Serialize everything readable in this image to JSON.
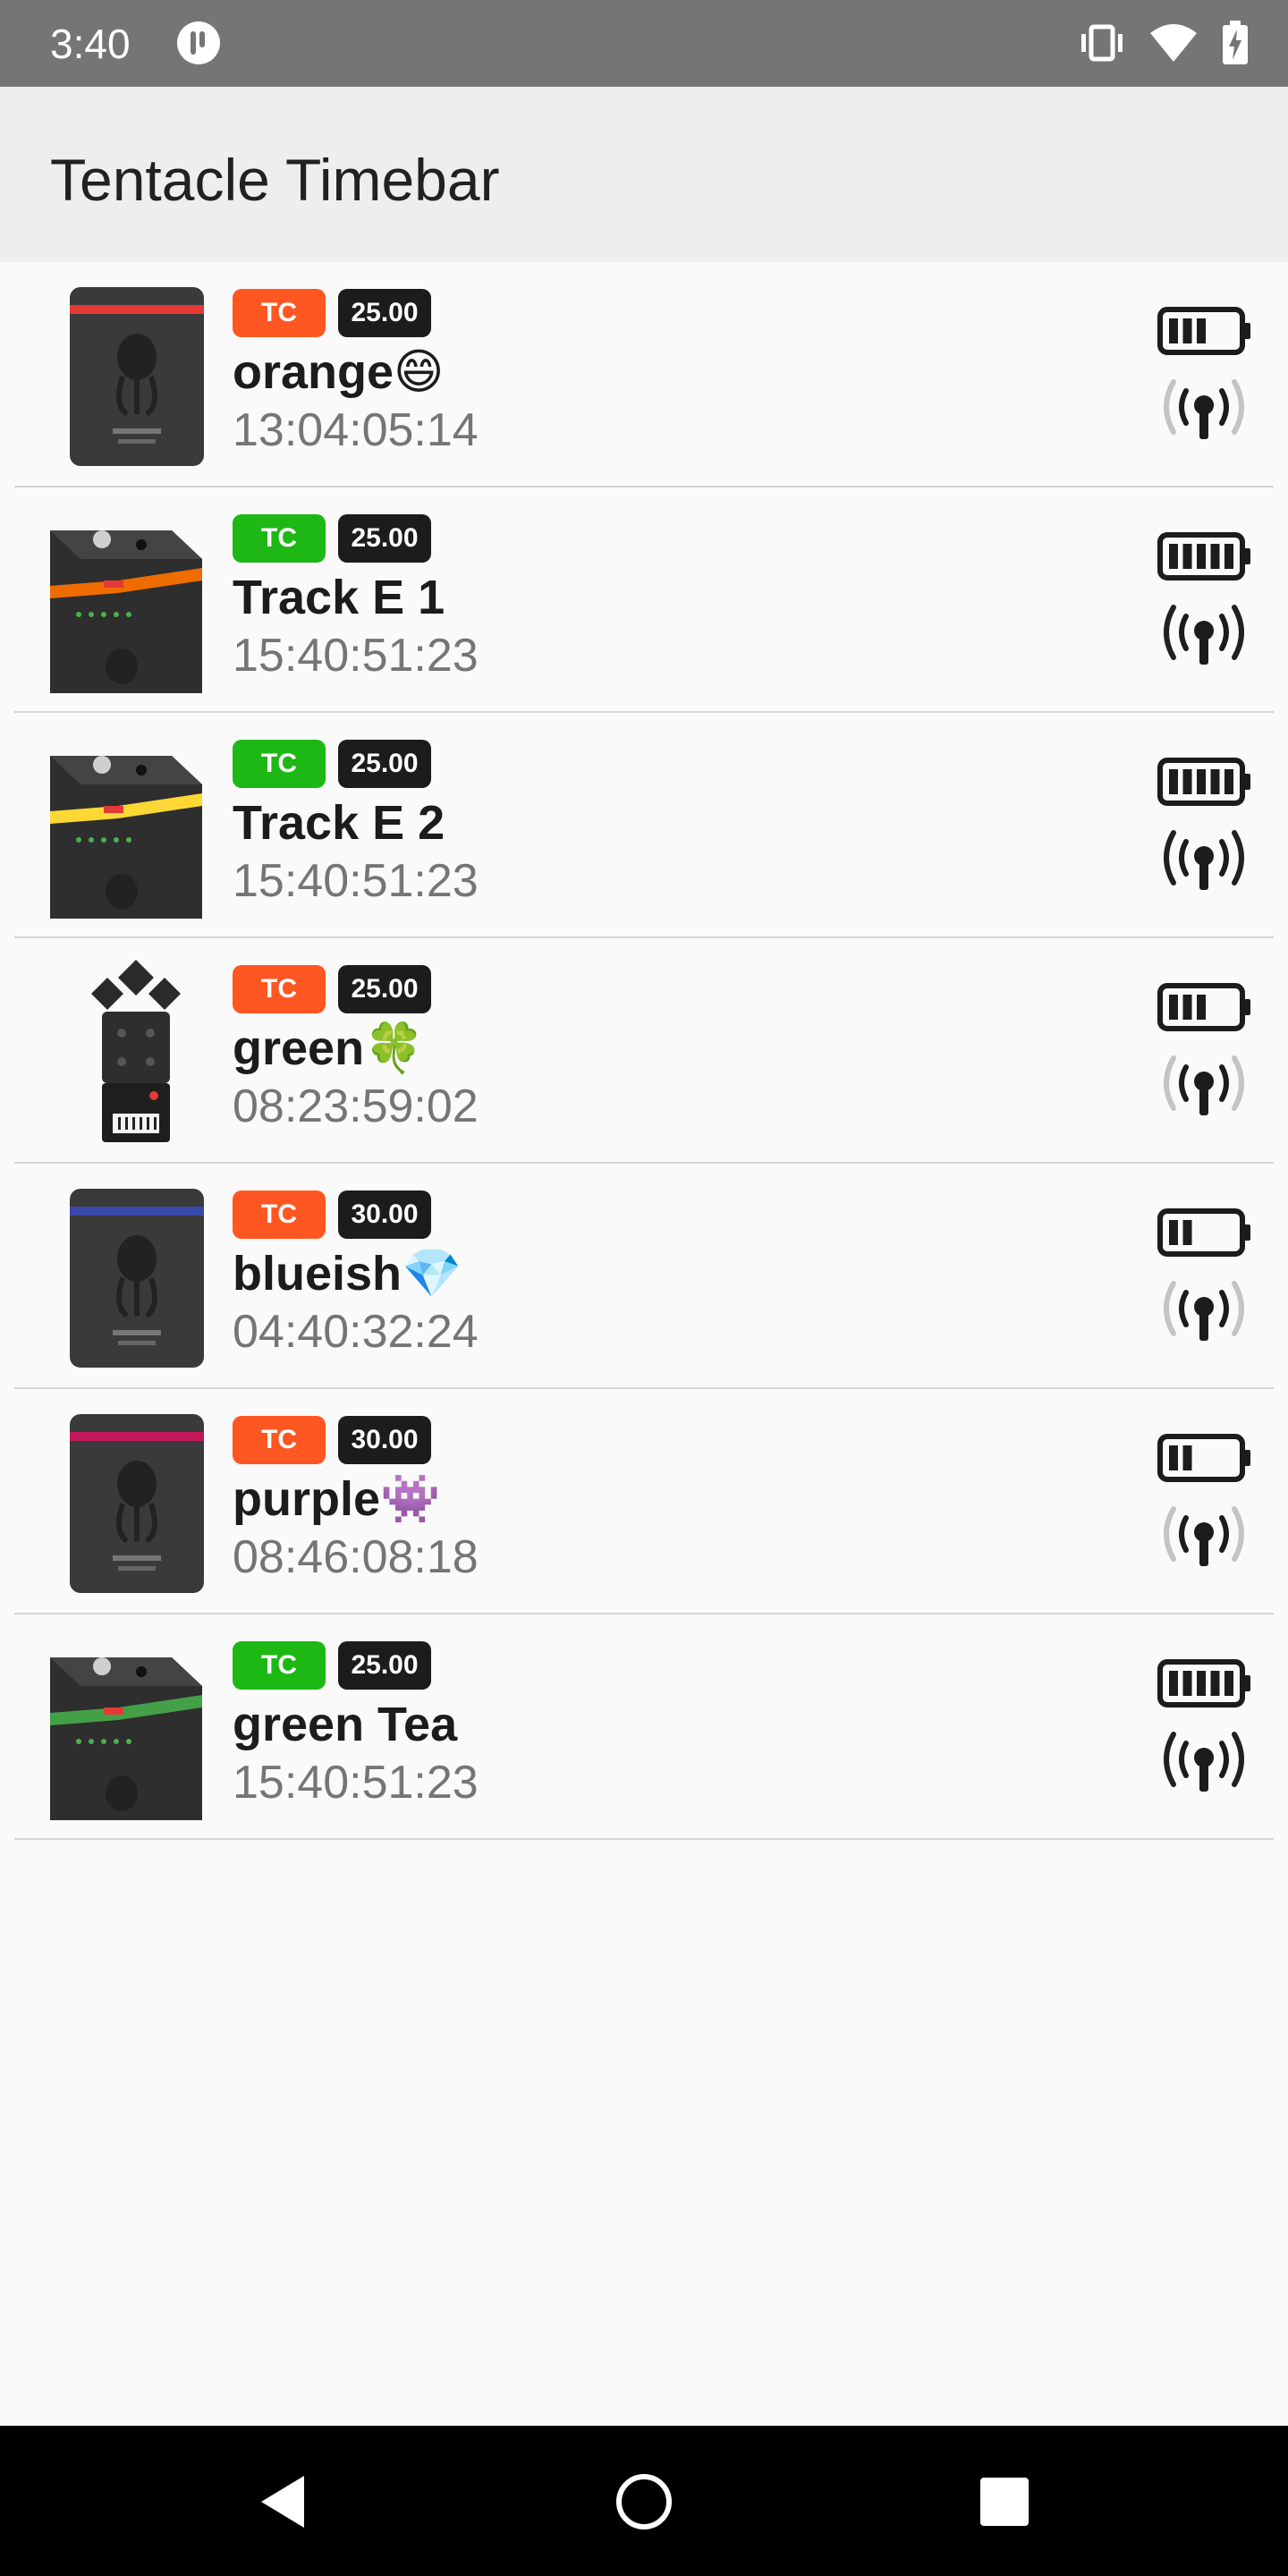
{
  "status_bar": {
    "time": "3:40"
  },
  "app_bar": {
    "title": "Tentacle Timebar",
    "accent": "#f4511e"
  },
  "colors": {
    "tc_orange": "#ff5722",
    "tc_green": "#1db814",
    "signal_strong": "#212121",
    "signal_weak": "#c4c4c4"
  },
  "devices": [
    {
      "tag": "TC",
      "fps": "25.00",
      "name": "orange😄",
      "timecode": "13:04:05:14",
      "tag_color": "#ff5722",
      "device_icon": "tentacle-sync-e-front-icon",
      "stripe": "#e53935",
      "battery_level": 3,
      "signal": "weak"
    },
    {
      "tag": "TC",
      "fps": "25.00",
      "name": "Track E 1",
      "timecode": "15:40:51:23",
      "tag_color": "#1db814",
      "device_icon": "tentacle-track-e-icon",
      "stripe": "#ef6c00",
      "battery_level": 5,
      "signal": "strong"
    },
    {
      "tag": "TC",
      "fps": "25.00",
      "name": "Track E 2",
      "timecode": "15:40:51:23",
      "tag_color": "#1db814",
      "device_icon": "tentacle-track-e-icon",
      "stripe": "#fdd835",
      "battery_level": 5,
      "signal": "strong"
    },
    {
      "tag": "TC",
      "fps": "25.00",
      "name": "green🍀",
      "timecode": "08:23:59:02",
      "tag_color": "#ff5722",
      "device_icon": "zoom-recorder-icon",
      "stripe": "",
      "battery_level": 3,
      "signal": "weak"
    },
    {
      "tag": "TC",
      "fps": "30.00",
      "name": "blueish💎",
      "timecode": "04:40:32:24",
      "tag_color": "#ff5722",
      "device_icon": "tentacle-sync-e-front-icon",
      "stripe": "#3949ab",
      "battery_level": 2,
      "signal": "weak"
    },
    {
      "tag": "TC",
      "fps": "30.00",
      "name": "purple👾",
      "timecode": "08:46:08:18",
      "tag_color": "#ff5722",
      "device_icon": "tentacle-sync-e-front-icon",
      "stripe": "#c2185b",
      "battery_level": 2,
      "signal": "weak"
    },
    {
      "tag": "TC",
      "fps": "25.00",
      "name": "green Tea",
      "timecode": "15:40:51:23",
      "tag_color": "#1db814",
      "device_icon": "tentacle-track-e-icon",
      "stripe": "#43a047",
      "battery_level": 5,
      "signal": "strong"
    }
  ]
}
